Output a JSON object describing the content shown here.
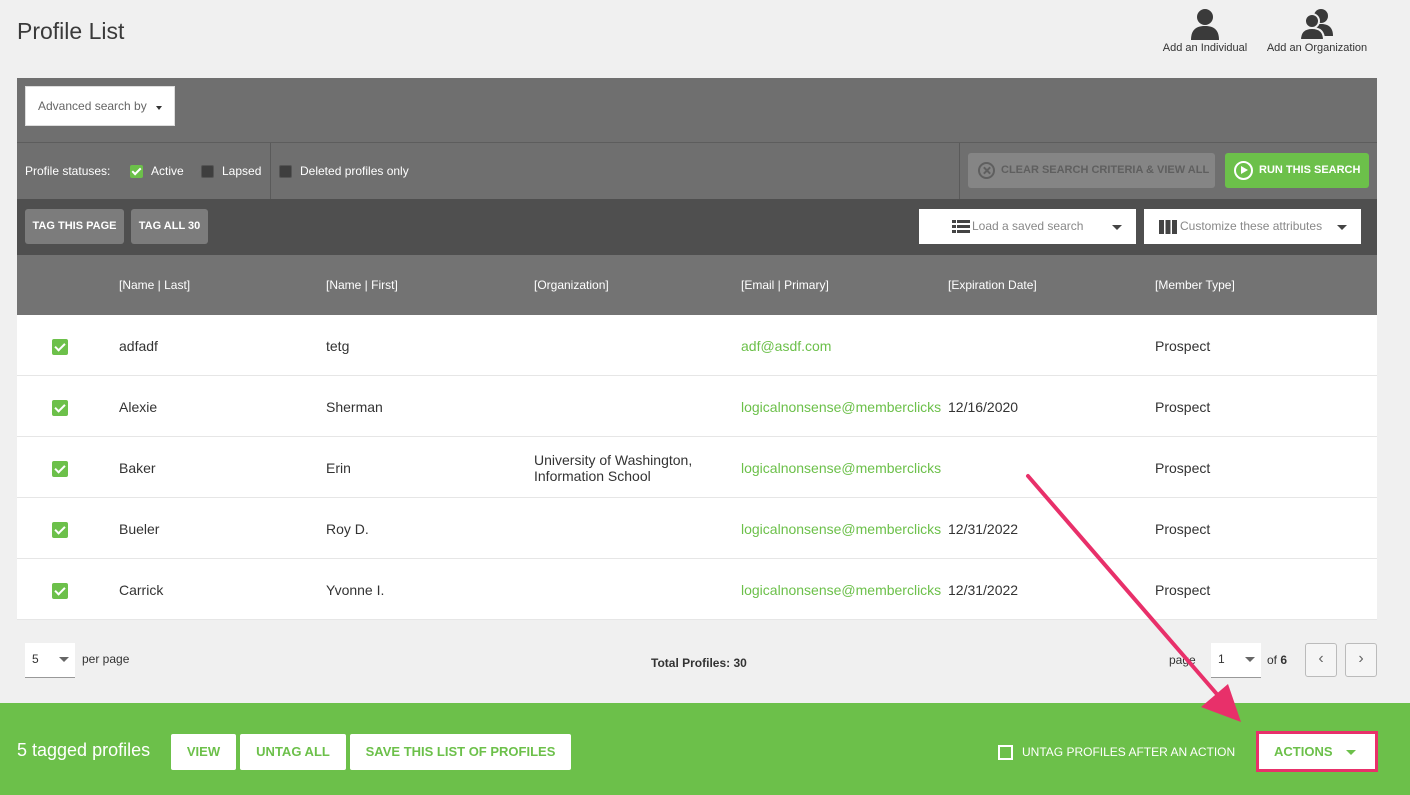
{
  "page": {
    "title": "Profile List"
  },
  "top_actions": {
    "add_individual": "Add an Individual",
    "add_organization": "Add an Organization"
  },
  "search": {
    "advanced_label": "Advanced search by",
    "statuses_label": "Profile statuses:",
    "status_active": "Active",
    "status_active_checked": true,
    "status_lapsed": "Lapsed",
    "status_lapsed_checked": false,
    "deleted_only": "Deleted profiles only",
    "deleted_only_checked": false,
    "clear_button": "CLEAR SEARCH CRITERIA & VIEW ALL",
    "run_button": "RUN THIS SEARCH"
  },
  "toolbar": {
    "tag_page": "TAG THIS PAGE",
    "tag_all": "TAG ALL 30",
    "load_saved": "Load a saved search",
    "customize": "Customize these attributes"
  },
  "table": {
    "columns": [
      "[Name | Last]",
      "[Name | First]",
      "[Organization]",
      "[Email | Primary]",
      "[Expiration Date]",
      "[Member Type]"
    ],
    "rows": [
      {
        "checked": true,
        "last": "adfadf",
        "first": "tetg",
        "org": "",
        "email": "adf@asdf.com",
        "expiration": "",
        "type": "Prospect"
      },
      {
        "checked": true,
        "last": "Alexie",
        "first": "Sherman",
        "org": "",
        "email": "logicalnonsense@memberclicks",
        "expiration": "12/16/2020",
        "type": "Prospect"
      },
      {
        "checked": true,
        "last": "Baker",
        "first": "Erin",
        "org_line1": "University of Washington,",
        "org_line2": "Information School",
        "email": "logicalnonsense@memberclicks",
        "expiration": "",
        "type": "Prospect"
      },
      {
        "checked": true,
        "last": "Bueler",
        "first": "Roy D.",
        "org": "",
        "email": "logicalnonsense@memberclicks",
        "expiration": "12/31/2022",
        "type": "Prospect"
      },
      {
        "checked": true,
        "last": "Carrick",
        "first": "Yvonne I.",
        "org": "",
        "email": "logicalnonsense@memberclicks",
        "expiration": "12/31/2022",
        "type": "Prospect"
      }
    ]
  },
  "pager": {
    "per_page_value": "5",
    "per_page_label": "per page",
    "total": "Total Profiles: 30",
    "page_label": "page",
    "page_value": "1",
    "of_label": "of",
    "total_pages": "6",
    "prev": "‹",
    "next": "›"
  },
  "footer": {
    "tagged_count": "5 tagged profiles",
    "view": "VIEW",
    "untag_all": "UNTAG ALL",
    "save_list": "SAVE THIS LIST OF PROFILES",
    "untag_after": "UNTAG PROFILES AFTER AN ACTION",
    "untag_after_checked": false,
    "actions": "ACTIONS"
  },
  "colors": {
    "accent_green": "#6cc04a",
    "annotation_pink": "#e8306a",
    "panel_gray": "#6f6f6f",
    "toolbar_gray": "#4f4f4f",
    "header_gray": "#737373"
  },
  "icons": {
    "add_individual": "person-icon",
    "add_organization": "people-icon",
    "clear": "x-circle-icon",
    "run": "play-circle-icon",
    "load_saved": "list-icon",
    "customize": "columns-icon"
  }
}
